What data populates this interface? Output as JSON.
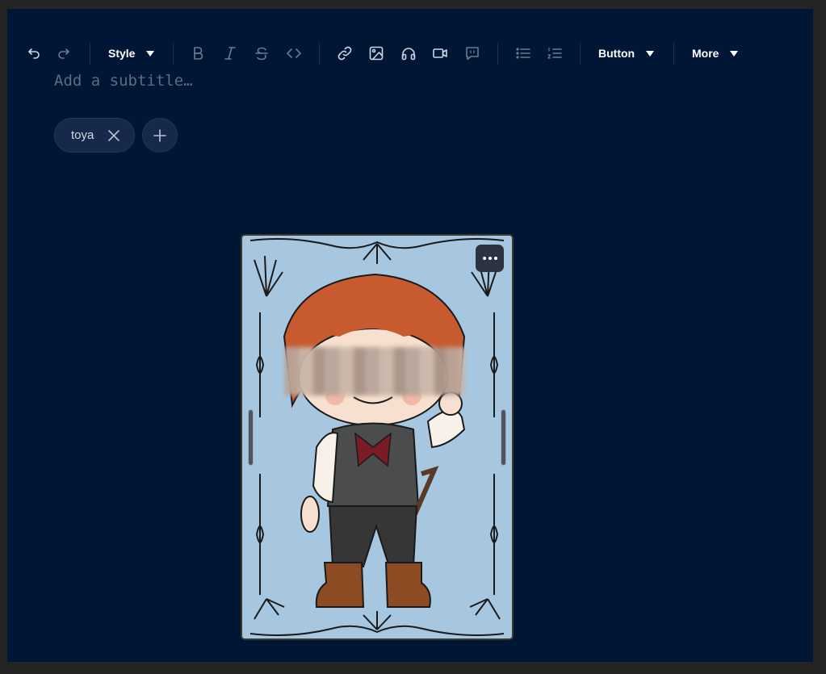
{
  "toolbar": {
    "style_label": "Style",
    "button_label": "Button",
    "more_label": "More"
  },
  "subtitle": {
    "placeholder": "Add a subtitle…",
    "value": ""
  },
  "tags": [
    {
      "label": "toya"
    }
  ],
  "colors": {
    "background": "#011635",
    "card_background": "#a7c7e1",
    "tag_background": "#17294a",
    "toolbar_icon": "#cfd6e3",
    "toolbar_icon_disabled": "#6d7a90"
  },
  "icons": {
    "undo": "undo-icon",
    "redo": "redo-icon",
    "bold": "bold-icon",
    "italic": "italic-icon",
    "strikethrough": "strikethrough-icon",
    "code": "code-icon",
    "link": "link-icon",
    "image": "image-icon",
    "audio": "headphones-icon",
    "video": "video-icon",
    "embed": "quote-bubble-icon",
    "bullet_list": "bullet-list-icon",
    "numbered_list": "numbered-list-icon",
    "tag_remove": "close-icon",
    "tag_add": "plus-icon",
    "card_menu": "more-horizontal-icon"
  }
}
